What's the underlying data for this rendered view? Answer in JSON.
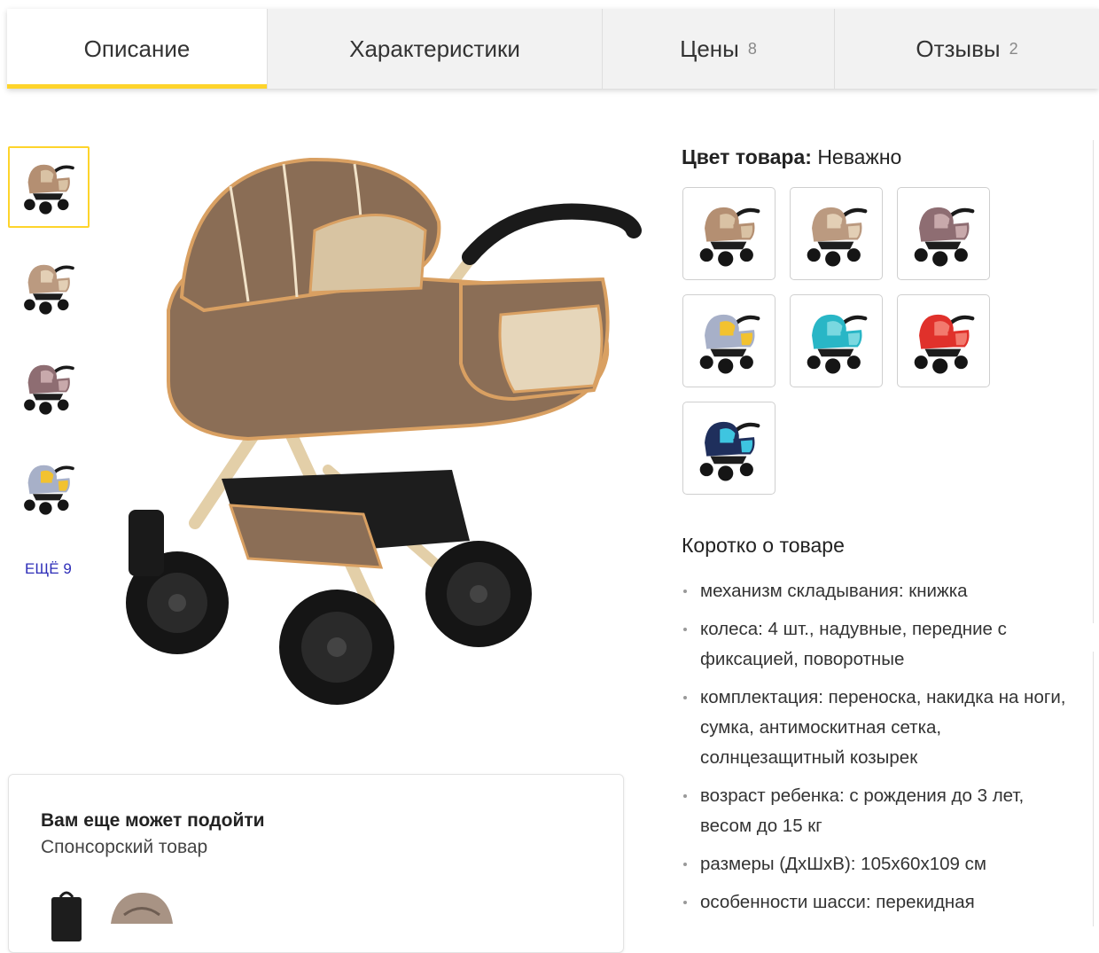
{
  "tabs": [
    {
      "label": "Описание",
      "count": ""
    },
    {
      "label": "Характеристики",
      "count": ""
    },
    {
      "label": "Цены",
      "count": "8"
    },
    {
      "label": "Отзывы",
      "count": "2"
    }
  ],
  "gallery": {
    "thumbnails": [
      "stroller-beige",
      "stroller-beige-light",
      "stroller-mauve",
      "stroller-grey-yellow"
    ],
    "more_label": "ЕЩЁ 9"
  },
  "colors": {
    "heading_label": "Цвет товара:",
    "selected_value": "Неважно",
    "swatches": [
      {
        "name": "stroller-beige",
        "body": "#b48f72",
        "accent": "#d9c2a4"
      },
      {
        "name": "stroller-beige-light",
        "body": "#bb9a80",
        "accent": "#e3cfb5"
      },
      {
        "name": "stroller-mauve",
        "body": "#8e6d72",
        "accent": "#c8a9ab"
      },
      {
        "name": "stroller-grey-yellow",
        "body": "#a7b0c8",
        "accent": "#f2c230"
      },
      {
        "name": "stroller-turquoise",
        "body": "#29b6c6",
        "accent": "#7ad8e0"
      },
      {
        "name": "stroller-red",
        "body": "#e0312b",
        "accent": "#f27a6e"
      },
      {
        "name": "stroller-navy",
        "body": "#1f2f5c",
        "accent": "#3ec5e0"
      }
    ]
  },
  "short_description": {
    "heading": "Коротко о товаре",
    "items": [
      "механизм складывания: книжка",
      "колеса: 4 шт., надувные, передние с фиксацией, поворотные",
      "комплектация: переноска, накидка на ноги, сумка, антимоскитная сетка, солнцезащитный козырек",
      "возраст ребенка: с рождения до 3 лет, весом до 15 кг",
      "размеры (ДхШхВ): 105x60x109 см",
      "особенности шасси: перекидная"
    ]
  },
  "sponsored": {
    "title": "Вам еще может подойти",
    "subtitle": "Спонсорский товар"
  },
  "theme": {
    "active_tab_underline": "#fed42b",
    "link_color": "#2e2eb8",
    "main_stroller_body": "#8b6e56",
    "main_stroller_trim": "#d9a062",
    "main_stroller_frame": "#e3cfa8"
  }
}
